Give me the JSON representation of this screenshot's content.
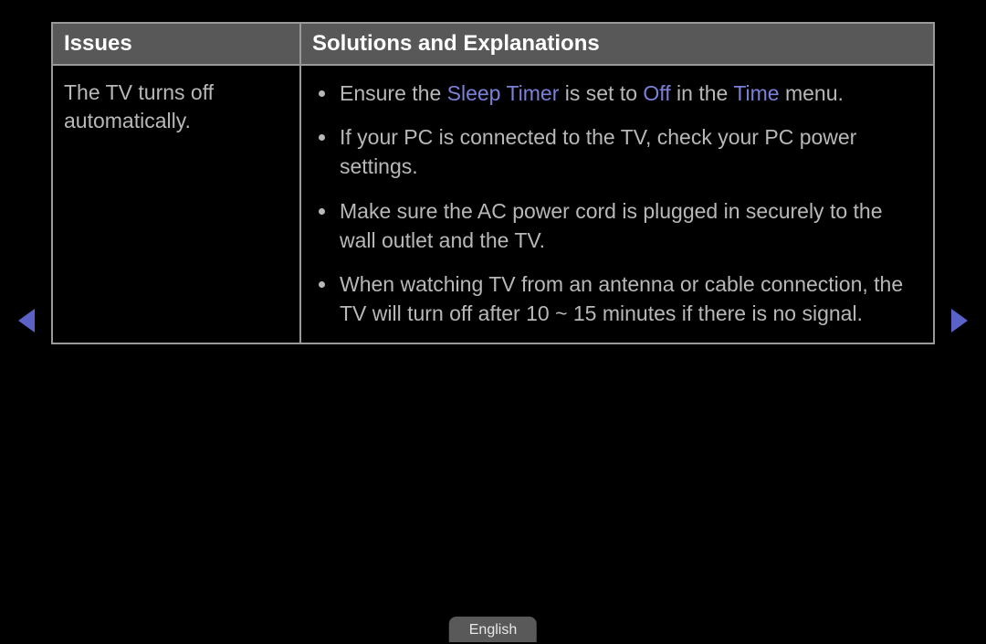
{
  "headers": {
    "issues": "Issues",
    "solutions": "Solutions and Explanations"
  },
  "row": {
    "issue_line1": "The TV turns off",
    "issue_line2": "automatically.",
    "bullet1_pre": "Ensure the ",
    "bullet1_hl1": "Sleep Timer",
    "bullet1_mid1": " is set to ",
    "bullet1_hl2": "Off",
    "bullet1_mid2": " in the ",
    "bullet1_hl3": "Time",
    "bullet1_post": " menu.",
    "bullet2": "If your PC is connected to the TV, check your PC power settings.",
    "bullet3": "Make sure the AC power cord is plugged in securely to the wall outlet and the TV.",
    "bullet4": "When watching TV from an antenna or cable connection, the TV will turn off after 10 ~ 15 minutes if there is no signal."
  },
  "footer": {
    "language": "English"
  }
}
